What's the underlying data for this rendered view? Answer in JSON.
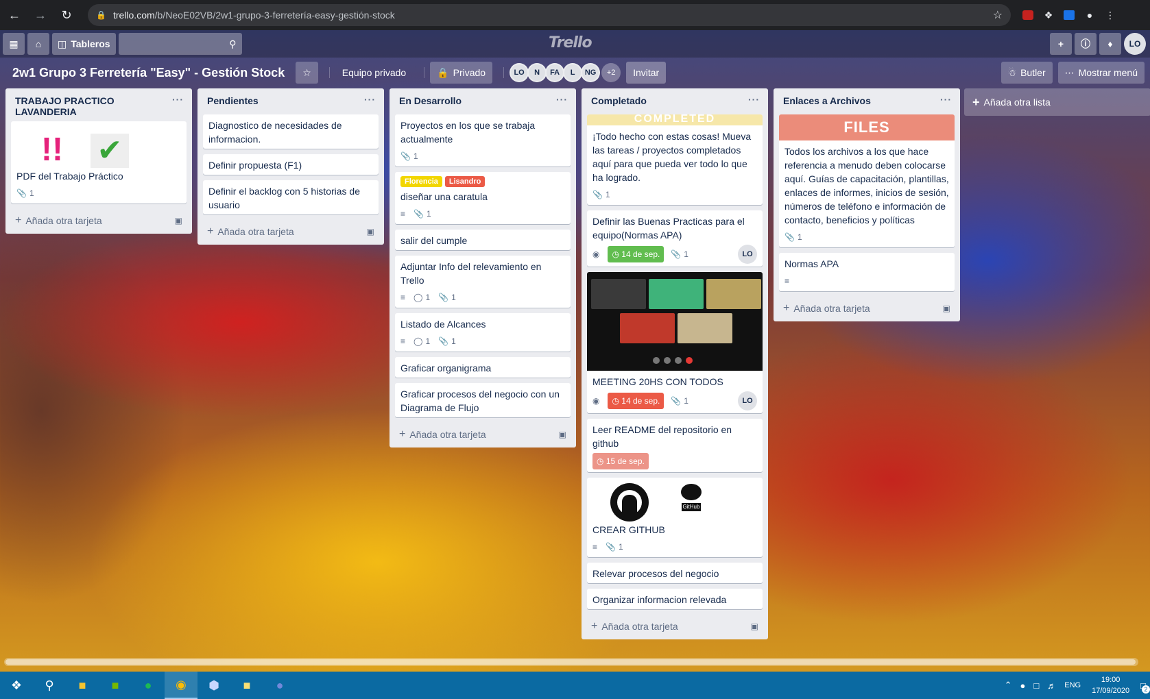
{
  "browser": {
    "url_host": "trello.com",
    "url_path": "/b/NeoE02VB/2w1-grupo-3-ferretería-easy-gestión-stock"
  },
  "header": {
    "boards_label": "Tableros",
    "logo_text": "Trello",
    "user_initials": "LO"
  },
  "board": {
    "title": "2w1 Grupo 3 Ferretería \"Easy\" - Gestión Stock",
    "team_label": "Equipo privado",
    "privacy_label": "Privado",
    "members": [
      "LO",
      "N",
      "FA",
      "L",
      "NG"
    ],
    "members_more": "+2",
    "invite_label": "Invitar",
    "butler_label": "Butler",
    "menu_label": "Mostrar menú"
  },
  "add_card_label": "Añada otra tarjeta",
  "add_list_label": "Añada otra lista",
  "lists": [
    {
      "title": "TRABAJO PRACTICO LAVANDERIA",
      "cards": [
        {
          "title": "PDF del Trabajo Práctico",
          "attachments": "1"
        }
      ]
    },
    {
      "title": "Pendientes",
      "cards": [
        {
          "title": "Diagnostico de necesidades de informacion."
        },
        {
          "title": "Definir propuesta (F1)"
        },
        {
          "title": "Definir el backlog con 5 historias de usuario"
        }
      ]
    },
    {
      "title": "En Desarrollo",
      "cards": [
        {
          "title": "Proyectos en los que se trabaja actualmente",
          "attachments": "1"
        },
        {
          "title": "diseñar una caratula",
          "labels": [
            "Florencia",
            "Lisandro"
          ],
          "attachments": "1"
        },
        {
          "title": "salir del cumple"
        },
        {
          "title": "Adjuntar Info del relevamiento en Trello",
          "comments": "1",
          "attachments": "1"
        },
        {
          "title": "Listado de Alcances",
          "comments": "1",
          "attachments": "1"
        },
        {
          "title": "Graficar organigrama"
        },
        {
          "title": "Graficar procesos del negocio con un Diagrama de Flujo"
        }
      ]
    },
    {
      "title": "Completado",
      "cards": [
        {
          "cover": "COMPLETED",
          "title": "¡Todo hecho con estas cosas! Mueva las tareas / proyectos completados aquí para que pueda ver todo lo que ha logrado.",
          "attachments": "1"
        },
        {
          "title": "Definir las Buenas Practicas para el equipo(Normas APA)",
          "due": "14 de sep.",
          "attachments": "1",
          "member": "LO"
        },
        {
          "title": "MEETING 20HS CON TODOS",
          "due": "14 de sep.",
          "attachments": "1",
          "member": "LO"
        },
        {
          "title": "Leer README del repositorio en github",
          "due": "15 de sep."
        },
        {
          "title": "CREAR GITHUB",
          "attachments": "1",
          "image_text": "GitHub"
        },
        {
          "title": "Relevar procesos del negocio"
        },
        {
          "title": "Organizar informacion relevada"
        }
      ]
    },
    {
      "title": "Enlaces a Archivos",
      "cards": [
        {
          "cover": "FILES",
          "title": "Todos los archivos a los que hace referencia a menudo deben colocarse aquí. Guías de capacitación, plantillas, enlaces de informes, inicios de sesión, números de teléfono e información de contacto, beneficios y políticas",
          "attachments": "1"
        },
        {
          "title": "Normas APA"
        }
      ]
    }
  ],
  "taskbar": {
    "lang": "ENG",
    "time": "19:00",
    "date": "17/09/2020",
    "notifications": "2"
  }
}
